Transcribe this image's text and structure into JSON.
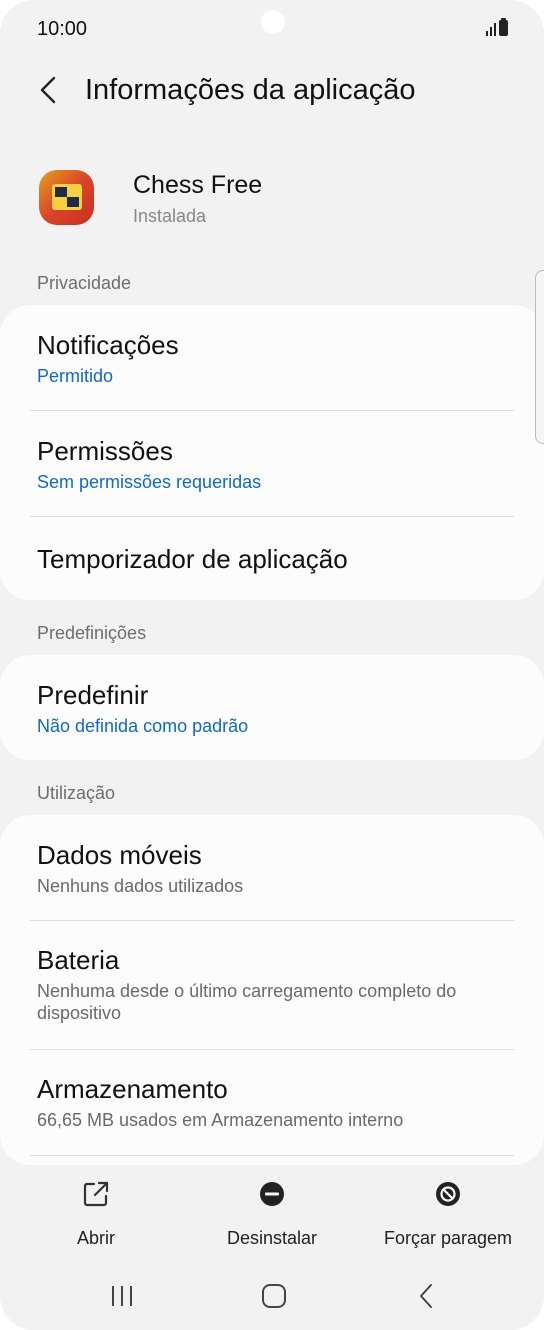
{
  "status_bar": {
    "time": "10:00"
  },
  "header": {
    "title": "Informações da aplicação",
    "back_icon": "chevron-left-icon"
  },
  "app": {
    "name": "Chess Free",
    "status": "Instalada",
    "icon": "chess-app-icon"
  },
  "sections": {
    "privacy": {
      "header": "Privacidade",
      "notifications": {
        "title": "Notificações",
        "subtitle": "Permitido"
      },
      "permissions": {
        "title": "Permissões",
        "subtitle": "Sem permissões requeridas"
      },
      "timer": {
        "title": "Temporizador de aplicação"
      }
    },
    "defaults": {
      "header": "Predefinições",
      "set_default": {
        "title": "Predefinir",
        "subtitle": "Não definida como padrão"
      }
    },
    "usage": {
      "header": "Utilização",
      "mobile_data": {
        "title": "Dados móveis",
        "subtitle": "Nenhuns dados utilizados"
      },
      "battery": {
        "title": "Bateria",
        "subtitle": "Nenhuma desde o último carregamento completo do dispositivo"
      },
      "storage": {
        "title": "Armazenamento",
        "subtitle": "66,65 MB usados em Armazenamento interno"
      }
    }
  },
  "actions": {
    "open": {
      "label": "Abrir",
      "icon": "open-external-icon"
    },
    "uninstall": {
      "label": "Desinstalar",
      "icon": "remove-circle-icon"
    },
    "force_stop": {
      "label": "Forçar paragem",
      "icon": "block-icon"
    }
  },
  "nav": {
    "recents_icon": "recents-icon",
    "home_icon": "home-icon",
    "back_icon": "back-icon"
  },
  "colors": {
    "background": "#f2f2f2",
    "card": "#fcfcfc",
    "accent_blue": "#1169c2",
    "secondary_text": "#6a6a6a"
  }
}
